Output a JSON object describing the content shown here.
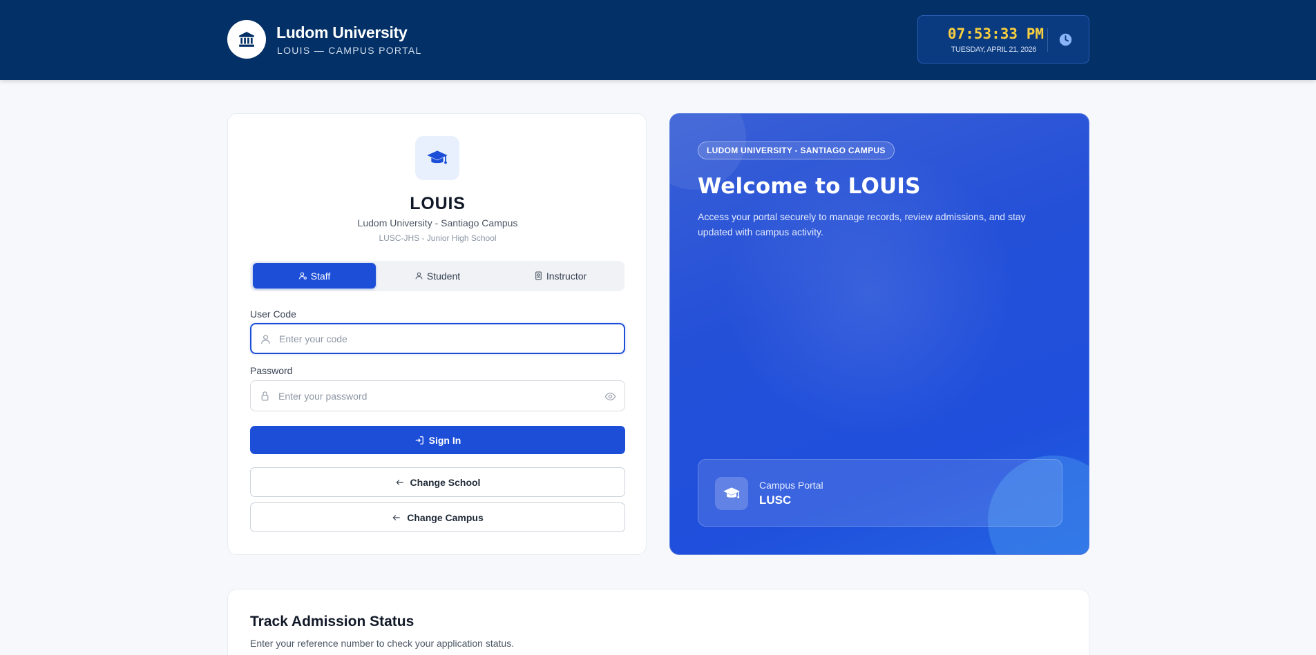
{
  "header": {
    "brand_name": "Ludom University",
    "brand_subtitle": "LOUIS — CAMPUS PORTAL",
    "clock_time": "07:53:33 PM",
    "clock_date": "TUESDAY, APRIL 21, 2026",
    "brand_icon": "university-building-icon",
    "clock_icon": "clock-icon"
  },
  "login": {
    "icon": "graduation-cap-icon",
    "title": "LOUIS",
    "campus": "Ludom University - Santiago Campus",
    "school": "LUSC-JHS - Junior High School",
    "roles": [
      {
        "label": "Staff",
        "icon": "staff-user-icon",
        "active": true
      },
      {
        "label": "Student",
        "icon": "user-icon",
        "active": false
      },
      {
        "label": "Instructor",
        "icon": "id-badge-icon",
        "active": false
      }
    ],
    "user_code": {
      "label": "User Code",
      "placeholder": "Enter your code",
      "value": ""
    },
    "password": {
      "label": "Password",
      "placeholder": "Enter your password",
      "value": ""
    },
    "signin_label": "Sign In",
    "change_school_label": "Change School",
    "change_campus_label": "Change Campus"
  },
  "welcome": {
    "chip": "LUDOM UNIVERSITY - SANTIAGO CAMPUS",
    "title": "Welcome to LOUIS",
    "description": "Access your portal securely to manage records, review admissions, and stay updated with campus activity.",
    "portal_label": "Campus Portal",
    "portal_code": "LUSC"
  },
  "track": {
    "title": "Track Admission Status",
    "description": "Enter your reference number to check your application status."
  },
  "colors": {
    "header_bg": "#033066",
    "primary": "#1d4ed8",
    "clock_time": "#f8cf3f",
    "page_bg": "#f6f8fb"
  }
}
